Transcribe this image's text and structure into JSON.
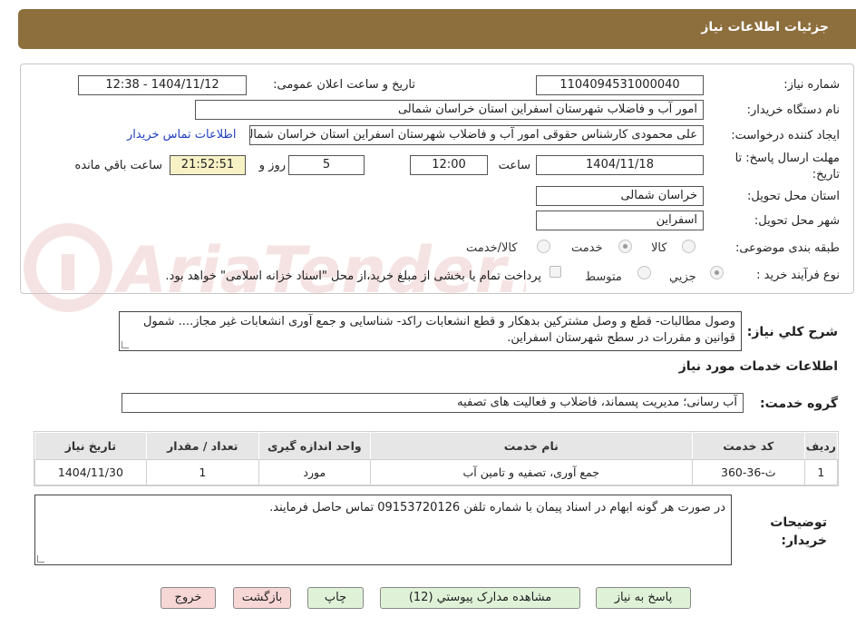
{
  "header": {
    "title": "جزئیات اطلاعات نیاز"
  },
  "form": {
    "need_number_label": "شماره نیاز:",
    "need_number": "1104094531000040",
    "announce_label": "تاریخ و ساعت اعلان عمومی:",
    "announce_value": "1404/11/12 - 12:38",
    "buyer_org_label": "نام دستگاه خریدار:",
    "buyer_org": "امور آب و فاضلاب شهرستان اسفراین استان خراسان شمالی",
    "requester_label": "ایجاد کننده درخواست:",
    "requester": "علی  محمودی  کارشناس حقوقی امور آب و فاضلاب شهرستان اسفراین استان خراسان شمالی",
    "contact_link": "اطلاعات تماس خریدار",
    "deadline_label": "مهلت ارسال پاسخ: تا تاریخ:",
    "deadline_date": "1404/11/18",
    "time_label": "ساعت",
    "deadline_time": "12:00",
    "days_value": "5",
    "days_label": "روز و",
    "remaining_time": "21:52:51",
    "remaining_label": "ساعت باقي مانده",
    "province_label": "استان محل تحویل:",
    "province": "خراسان شمالی",
    "city_label": "شهر محل تحویل:",
    "city": "اسفراین",
    "category_label": "طبقه بندی موضوعی:",
    "category_options": [
      "کالا",
      "خدمت",
      "کالا/خدمت"
    ],
    "category_selected": "خدمت",
    "process_label": "نوع فرآیند خرید :",
    "process_options": [
      "جزیي",
      "متوسط"
    ],
    "process_selected": "جزیي",
    "payment_note": "پرداخت تمام یا بخشی از مبلغ خرید،از محل \"اسناد خزانه اسلامی\" خواهد بود."
  },
  "description": {
    "label": "شرح کلي نیاز:",
    "text": "وصول مطالبات- قطع و وصل مشترکین بدهکار و قطع انشعابات راکد- شناسایی و جمع آوری انشعابات غیر مجاز.... شمول قوانین و مقررات در سطح شهرستان اسفراین."
  },
  "services": {
    "section_title": "اطلاعات خدمات مورد نیاز",
    "group_label": "گروه خدمت:",
    "group_value": "آب رسانی؛ مدیریت پسماند، فاضلاب و فعالیت های تصفیه",
    "columns": [
      "ردیف",
      "کد خدمت",
      "نام خدمت",
      "واحد اندازه گیری",
      "تعداد / مقدار",
      "تاریخ نیاز"
    ],
    "rows": [
      [
        "1",
        "ث-36-360",
        "جمع آوری، تصفیه و تامین آب",
        "مورد",
        "1",
        "1404/11/30"
      ]
    ]
  },
  "buyer_notes": {
    "label": "توضیحات خریدار:",
    "text": "در صورت هر گونه ابهام در اسناد پیمان با شماره تلفن 09153720126 تماس حاصل فرمایند."
  },
  "buttons": {
    "reply": "پاسخ به نیاز",
    "view_docs": "مشاهده مدارک پیوستي (12)",
    "print": "چاپ",
    "back": "بازگشت",
    "exit": "خروج"
  },
  "colors": {
    "header": "#8d6e3d",
    "button_green": "#dff2d8",
    "button_pink": "#f7d6d6",
    "link": "#1f3fbf"
  }
}
